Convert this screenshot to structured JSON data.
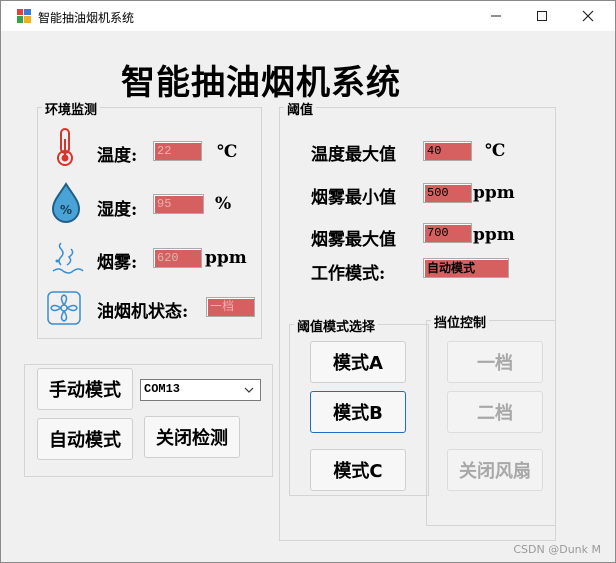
{
  "window": {
    "title": "智能抽油烟机系统",
    "minimize_icon": "minimize-icon",
    "maximize_icon": "maximize-icon",
    "close_icon": "close-icon"
  },
  "header": {
    "title": "智能抽油烟机系统"
  },
  "env": {
    "group_label": "环境监测",
    "temp": {
      "label": "温度:",
      "value": "22",
      "unit": "℃",
      "icon": "thermometer-icon"
    },
    "humidity": {
      "label": "湿度:",
      "value": "95",
      "unit": "%",
      "icon": "humidity-drop-icon"
    },
    "smoke": {
      "label": "烟雾:",
      "value": "620",
      "unit": "ppm",
      "icon": "smoke-icon"
    },
    "fan": {
      "label": "油烟机状态:",
      "value": "一档",
      "icon": "fan-icon"
    }
  },
  "threshold": {
    "group_label": "阈值",
    "temp_max": {
      "label": "温度最大值",
      "value": "40",
      "unit": "℃"
    },
    "smoke_min": {
      "label": "烟雾最小值",
      "value": "500",
      "unit": "ppm"
    },
    "smoke_max": {
      "label": "烟雾最大值",
      "value": "700",
      "unit": "ppm"
    },
    "work_mode": {
      "label": "工作模式:",
      "value": "自动模式"
    }
  },
  "mode_select": {
    "group_label": "阈值模式选择",
    "buttons": [
      "模式A",
      "模式B",
      "模式C"
    ]
  },
  "gear": {
    "group_label": "挡位控制",
    "buttons": [
      "一档",
      "二档",
      "关闭风扇"
    ]
  },
  "controls": {
    "manual_label": "手动模式",
    "auto_label": "自动模式",
    "close_detect_label": "关闭检测",
    "port_value": "COM13"
  },
  "watermark": "CSDN @Dunk M",
  "colors": {
    "value_box": "#d66060",
    "selected_border": "#1f6cc0"
  }
}
